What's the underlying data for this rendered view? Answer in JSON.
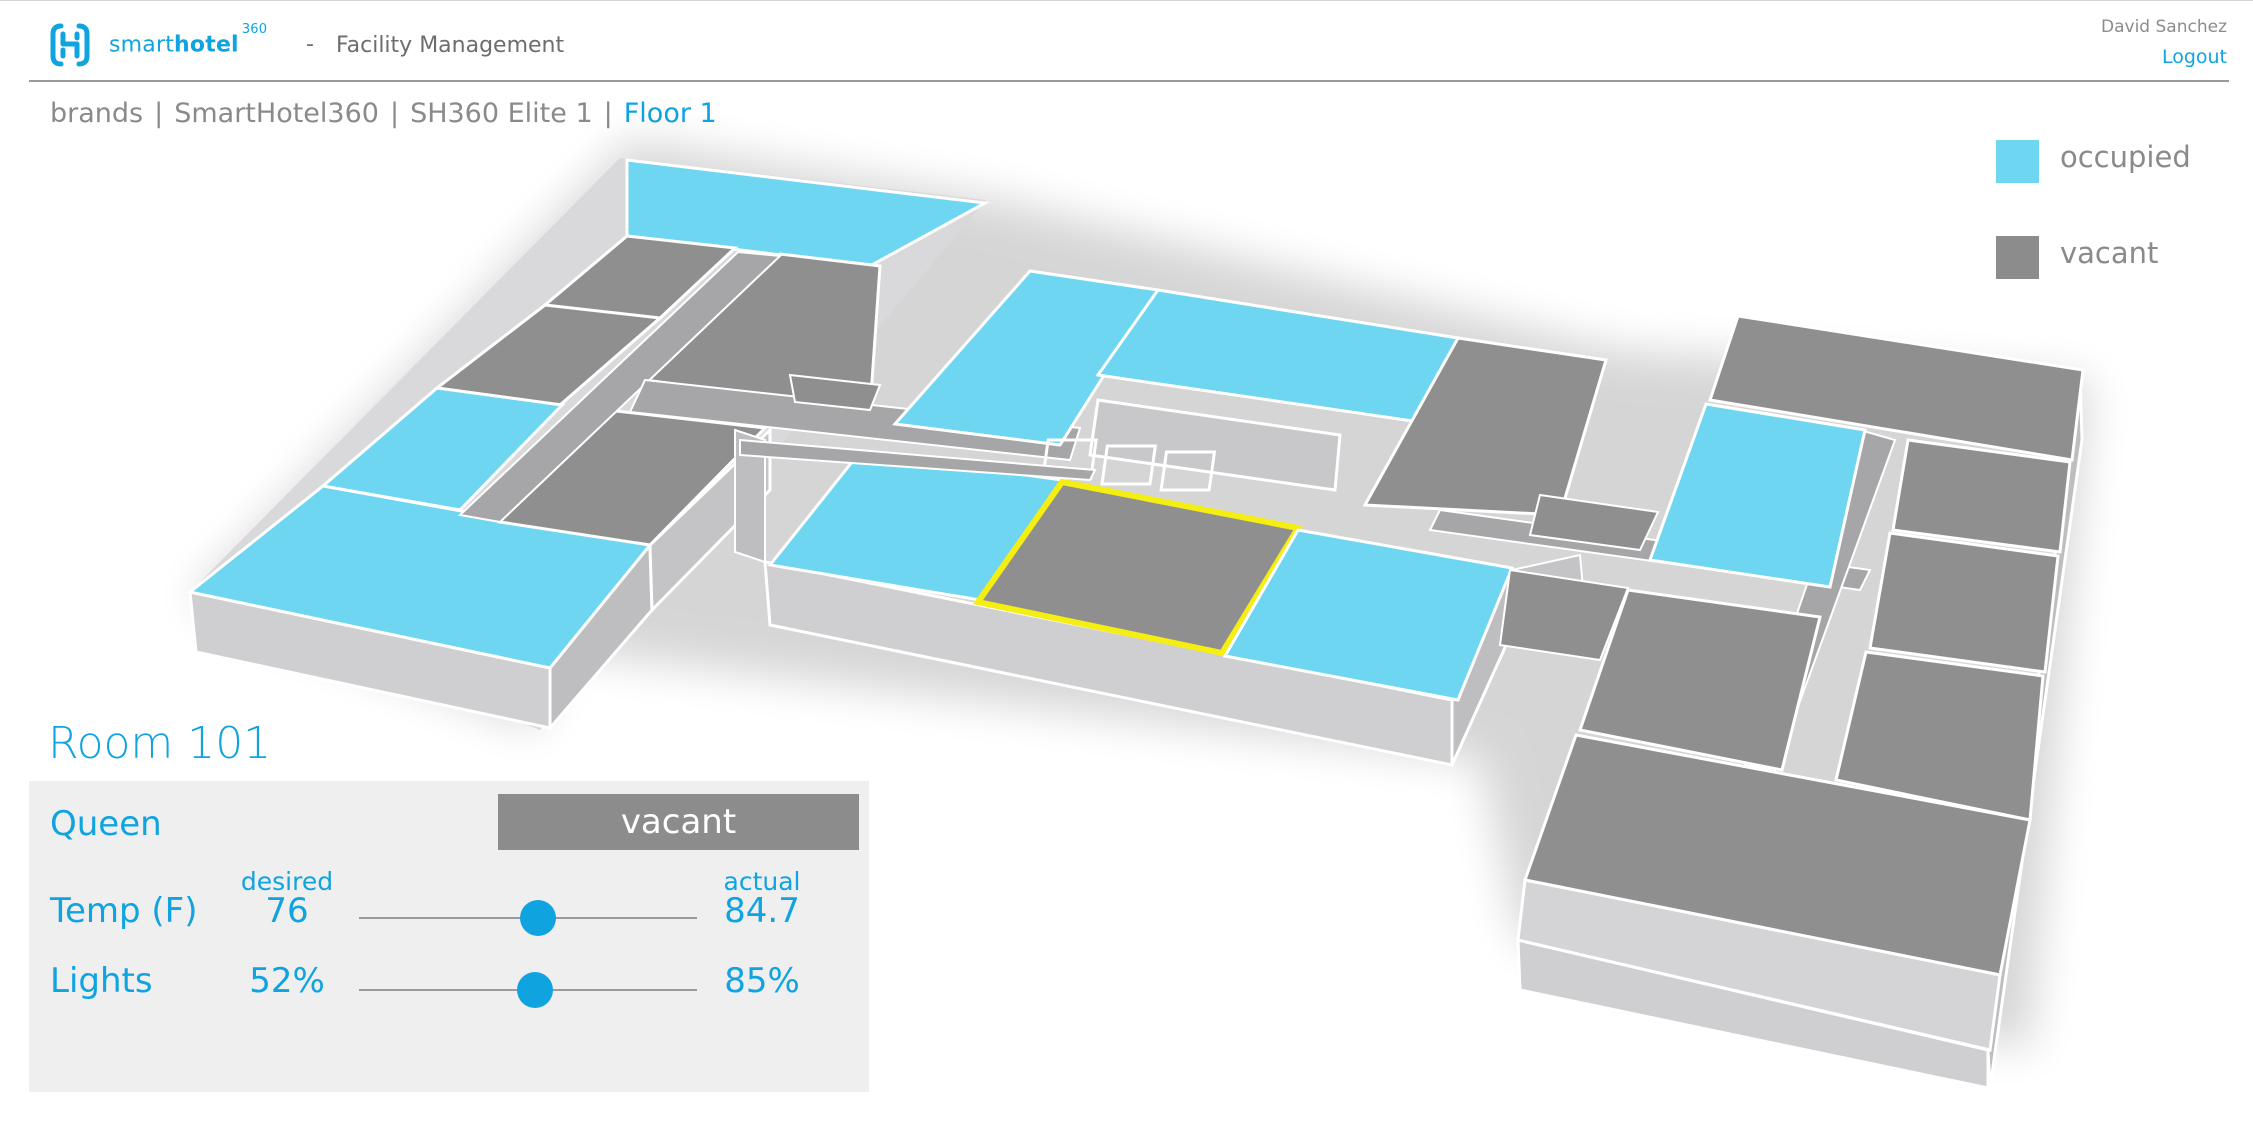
{
  "header": {
    "brand_prefix": "smart",
    "brand_bold": "hotel",
    "brand_super": "360",
    "separator": "-",
    "app_title": "Facility Management",
    "user_name": "David Sanchez",
    "logout_label": "Logout"
  },
  "breadcrumb": {
    "items": [
      "brands",
      "SmartHotel360",
      "SH360 Elite 1",
      "Floor 1"
    ],
    "separator": "|"
  },
  "legend": {
    "occupied_label": "occupied",
    "vacant_label": "vacant",
    "occupied_color": "#6fd6f2",
    "vacant_color": "#8c8c8c"
  },
  "room": {
    "title": "Room 101",
    "type": "Queen",
    "status": "vacant",
    "desired_label": "desired",
    "actual_label": "actual",
    "temp_label": "Temp (F)",
    "temp_desired": "76",
    "temp_actual": "84.7",
    "temp_slider_fraction": 0.53,
    "lights_label": "Lights",
    "lights_desired": "52%",
    "lights_actual": "85%",
    "lights_slider_fraction": 0.52
  },
  "colors": {
    "accent": "#0fa4e0",
    "occupied": "#6fd6f2",
    "vacant_floor": "#8f8f8f",
    "selected_outline": "#f5ee12"
  }
}
